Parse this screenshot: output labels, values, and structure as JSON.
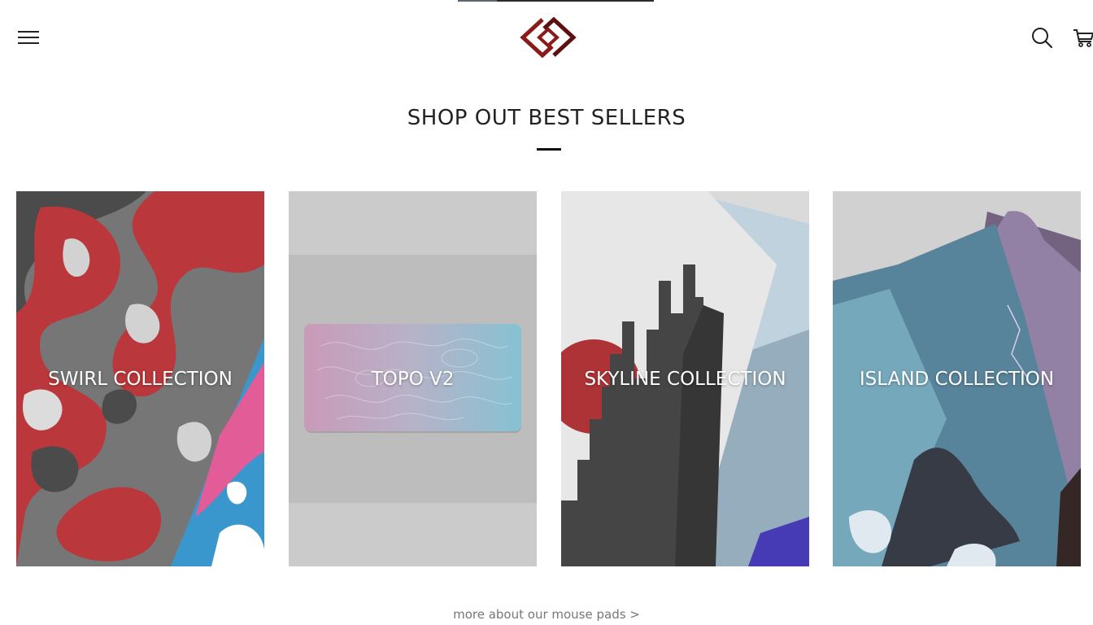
{
  "header": {
    "menu_icon": "hamburger-menu-icon",
    "logo_icon": "interlocked-diamond-logo",
    "search_icon": "search-icon",
    "cart_icon": "cart-icon",
    "brand_color": "#8b1a1a"
  },
  "section": {
    "title": "SHOP OUT BEST SELLERS"
  },
  "cards": [
    {
      "label": "SWIRL COLLECTION"
    },
    {
      "label": "TOPO V2"
    },
    {
      "label": "SKYLINE COLLECTION"
    },
    {
      "label": "ISLAND COLLECTION"
    }
  ],
  "footer": {
    "more_link": "more about our mouse pads >"
  }
}
